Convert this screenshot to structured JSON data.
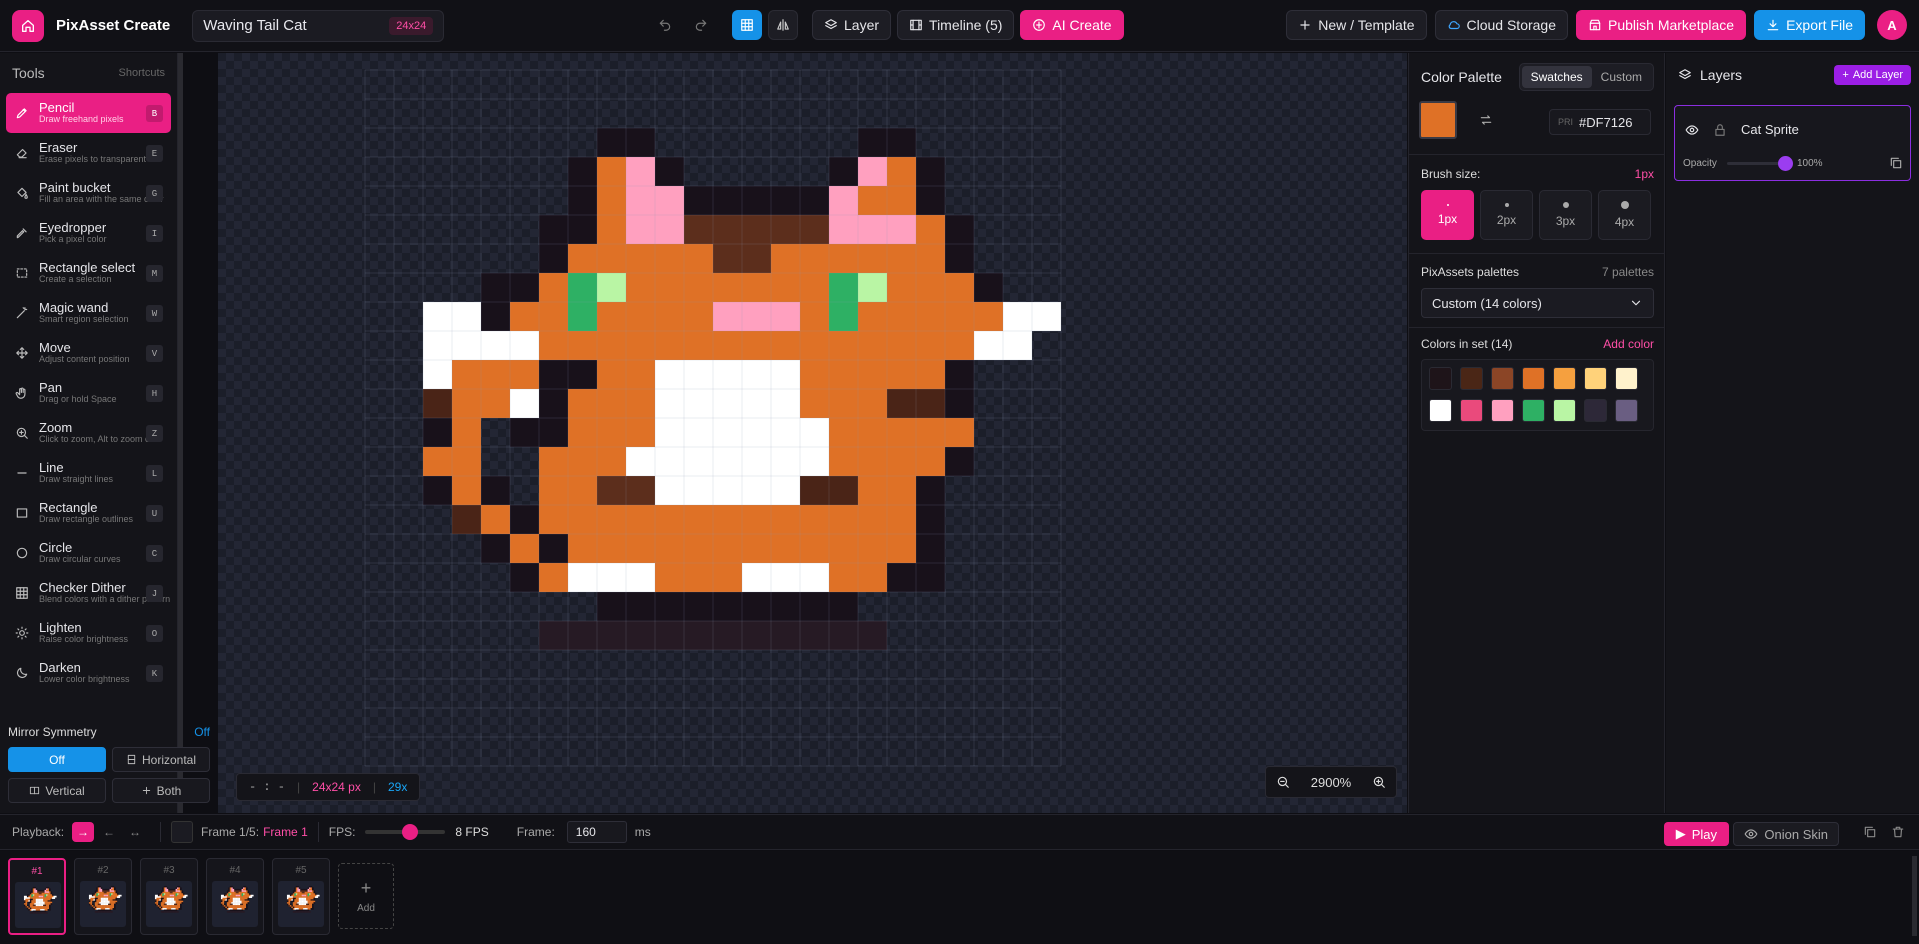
{
  "app": {
    "title": "PixAsset Create"
  },
  "file": {
    "name": "Waving Tail Cat",
    "size": "24x24"
  },
  "toolbar": {
    "layer": "Layer",
    "timeline": "Timeline (5)",
    "ai_create": "AI Create",
    "new_template": "New / Template",
    "cloud_storage": "Cloud Storage",
    "publish": "Publish Marketplace",
    "export": "Export File",
    "avatar": "A"
  },
  "tools": {
    "title": "Tools",
    "shortcuts": "Shortcuts",
    "items": [
      {
        "name": "Pencil",
        "desc": "Draw freehand pixels",
        "key": "B",
        "icon": "pencil-icon"
      },
      {
        "name": "Eraser",
        "desc": "Erase pixels to transparent",
        "key": "E",
        "icon": "eraser-icon"
      },
      {
        "name": "Paint bucket",
        "desc": "Fill an area with the same color",
        "key": "G",
        "icon": "paint-bucket-icon"
      },
      {
        "name": "Eyedropper",
        "desc": "Pick a pixel color",
        "key": "I",
        "icon": "eyedropper-icon"
      },
      {
        "name": "Rectangle select",
        "desc": "Create a selection",
        "key": "M",
        "icon": "rectangle-select-icon"
      },
      {
        "name": "Magic wand",
        "desc": "Smart region selection",
        "key": "W",
        "icon": "magic-wand-icon"
      },
      {
        "name": "Move",
        "desc": "Adjust content position",
        "key": "V",
        "icon": "move-icon"
      },
      {
        "name": "Pan",
        "desc": "Drag or hold Space",
        "key": "H",
        "icon": "hand-icon"
      },
      {
        "name": "Zoom",
        "desc": "Click to zoom, Alt to zoom out",
        "key": "Z",
        "icon": "zoom-icon"
      },
      {
        "name": "Line",
        "desc": "Draw straight lines",
        "key": "L",
        "icon": "line-icon"
      },
      {
        "name": "Rectangle",
        "desc": "Draw rectangle outlines",
        "key": "U",
        "icon": "rectangle-icon"
      },
      {
        "name": "Circle",
        "desc": "Draw circular curves",
        "key": "C",
        "icon": "circle-icon"
      },
      {
        "name": "Checker Dither",
        "desc": "Blend colors with a dither pattern",
        "key": "J",
        "icon": "dither-icon"
      },
      {
        "name": "Lighten",
        "desc": "Raise color brightness",
        "key": "O",
        "icon": "sun-icon"
      },
      {
        "name": "Darken",
        "desc": "Lower color brightness",
        "key": "K",
        "icon": "moon-icon"
      }
    ]
  },
  "mirror": {
    "title": "Mirror Symmetry",
    "state": "Off",
    "off": "Off",
    "horizontal": "Horizontal",
    "vertical": "Vertical",
    "both": "Both"
  },
  "canvas": {
    "coords": "- : -",
    "dims": "24x24 px",
    "zoom_short": "29x",
    "zoom_level": "2900%",
    "palette": {
      "a": "#18111a",
      "b": "#df7126",
      "c": "#ffa0bf",
      "d": "#5c2e1c",
      "w": "#ffffff",
      "g": "#2eb064",
      "l": "#b9f5a4",
      "m": "#4a2417",
      "e": "#261a24"
    },
    "pixels": [
      "........................",
      "........................",
      "........aa.......aa.....",
      ".......abca.....acba....",
      ".......abccaaaaacbba....",
      "......aabccdddddcccba...",
      "......abbbbbddbbbbbba...",
      "....aabglbbbbbbbglbbba..",
      "..wwabbgbbbbcccbgbbbbbww",
      "..wwwwbbbbbbbbbbbbbbbww.",
      "..wbbbaabbwwwwwbbbbba...",
      "..mbbwabbbwwwwwbbbmma...",
      "..ab.aabbbwwwwwwbbbbb...",
      "..bb..bbbwwwwwwwbbbba...",
      "..aba.bbddwwwwwmmbba....",
      "...mbabbbbbbbbbbbbba....",
      "....ababbbbbbbbbbbba....",
      ".....abwwwbbbwwwbbaa....",
      "........aaaaaaaaa.......",
      "......eeeeeeeeeeee......",
      "........................",
      "........................",
      "........................",
      "........................"
    ]
  },
  "color_panel": {
    "title": "Color Palette",
    "tab_swatches": "Swatches",
    "tab_custom": "Custom",
    "primary_color": "#DF7126",
    "pri_label": "PRI",
    "hex": "#DF7126",
    "brush_size_label": "Brush size:",
    "brush_size_value": "1px",
    "brush_sizes": [
      "1px",
      "2px",
      "3px",
      "4px"
    ],
    "palettes_label": "PixAssets palettes",
    "palettes_count": "7 palettes",
    "palette_select": "Custom (14 colors)",
    "colors_in_set": "Colors in set (14)",
    "add_color": "Add color",
    "swatches": [
      "#1e1419",
      "#4a2616",
      "#8b4526",
      "#df7126",
      "#f5a03f",
      "#ffd27a",
      "#fff2cc",
      "#ffffff",
      "#ea4a7c",
      "#ffa0bf",
      "#2eb064",
      "#b9f5a4",
      "#2d2838",
      "#6a5e82"
    ]
  },
  "layers": {
    "title": "Layers",
    "add": "Add Layer",
    "layer_name": "Cat Sprite",
    "opacity_label": "Opacity",
    "opacity_value": "100%",
    "opacity": 1.0
  },
  "playback": {
    "label": "Playback:",
    "frame_info": "Frame 1/5:",
    "frame_name": "Frame 1",
    "fps_label": "FPS:",
    "fps_value": "8 FPS",
    "fps": 8,
    "frame_label": "Frame:",
    "frame_ms": "160",
    "ms": "ms",
    "play": "Play",
    "onion": "Onion Skin"
  },
  "frames": {
    "items": [
      "#1",
      "#2",
      "#3",
      "#4",
      "#5"
    ],
    "add": "Add"
  }
}
